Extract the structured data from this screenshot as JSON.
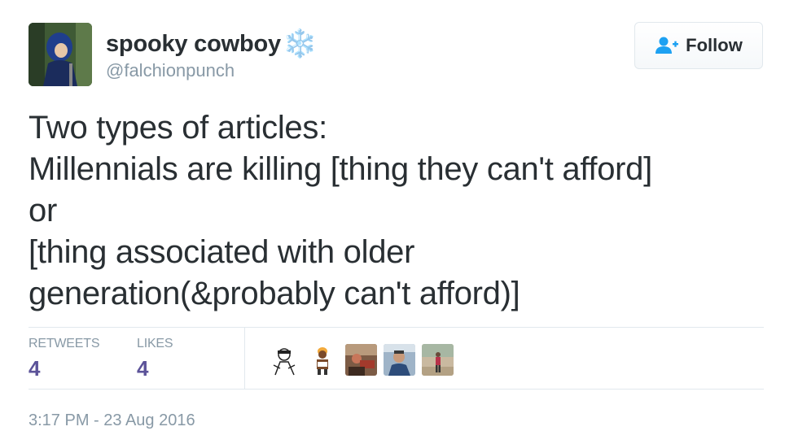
{
  "author": {
    "display_name": "spooky cowboy",
    "emoji": "❄️",
    "handle": "@falchionpunch"
  },
  "follow_button": {
    "label": "Follow",
    "icon": "add-user-icon"
  },
  "tweet": {
    "lines": [
      "Two types of articles:",
      "Millennials are killing [thing they can't afford]",
      "or",
      "[thing associated with older",
      "generation(&probably can't afford)]"
    ]
  },
  "stats": {
    "retweets_label": "RETWEETS",
    "retweets_count": "4",
    "likes_label": "LIKES",
    "likes_count": "4"
  },
  "likers": [
    "liker-avatar",
    "liker-avatar",
    "liker-avatar",
    "liker-avatar",
    "liker-avatar"
  ],
  "timestamp": "3:17 PM - 23 Aug 2016",
  "colors": {
    "text": "#292f33",
    "muted": "#8899a6",
    "count": "#5c5399",
    "follow_icon": "#1da1f2",
    "border": "#e1e8ed"
  }
}
